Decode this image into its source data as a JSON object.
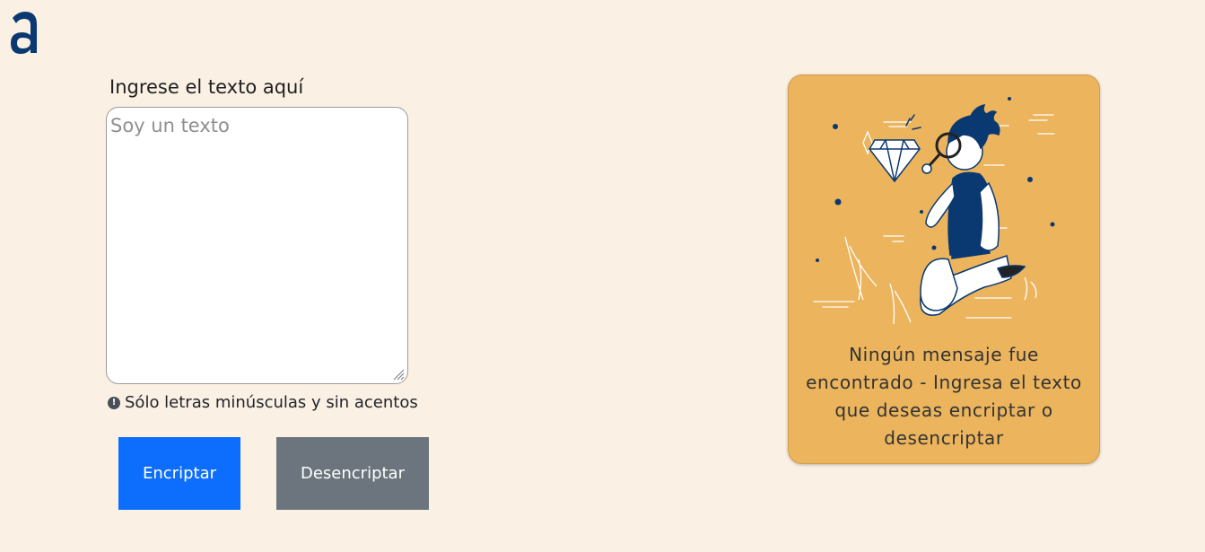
{
  "logo": {
    "glyph": "a",
    "color": "#0a3871"
  },
  "input": {
    "label": "Ingrese el texto aquí",
    "placeholder": "Soy un texto",
    "value": ""
  },
  "hint": {
    "icon": "exclamation-circle-icon",
    "text": "Sólo letras minúsculas y sin acentos"
  },
  "buttons": {
    "encrypt_label": "Encriptar",
    "decrypt_label": "Desencriptar",
    "encrypt_color": "#0d6efd",
    "decrypt_color": "#6c757d"
  },
  "output": {
    "message": "Ningún mensaje fue encontrado - Ingresa el texto que deseas encriptar o desencriptar",
    "illustration": "person-with-magnifying-glass-illustration",
    "card_color": "#ebb45d"
  }
}
